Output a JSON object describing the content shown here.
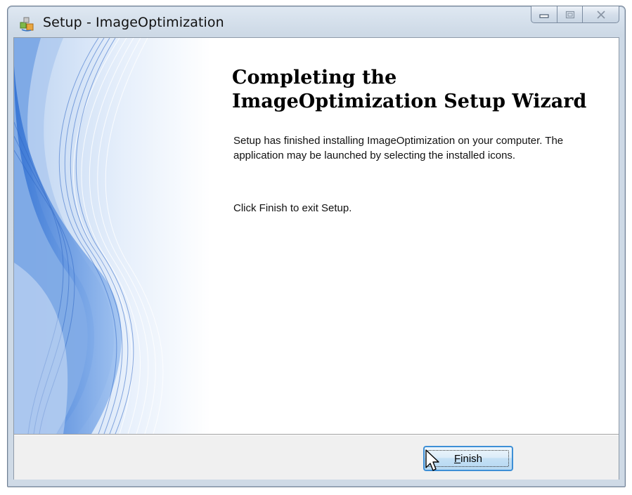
{
  "window": {
    "title": "Setup - ImageOptimization",
    "icon": "setup-wizard-icon",
    "caption_buttons": [
      "minimize-icon",
      "maximize-icon",
      "close-icon"
    ]
  },
  "wizard": {
    "heading_line1": "Completing the",
    "heading_line2": "ImageOptimization Setup Wizard",
    "paragraph1": "Setup has finished installing ImageOptimization on your computer. The application may be launched by selecting the installed icons.",
    "paragraph2": "Click Finish to exit Setup."
  },
  "footer": {
    "finish_label_accel": "F",
    "finish_label_rest": "inish"
  },
  "colors": {
    "accent": "#3d8fd6",
    "titlebar": "#d6e1ec",
    "panel": "#f0f0f0",
    "wave": "#4f86d8"
  }
}
